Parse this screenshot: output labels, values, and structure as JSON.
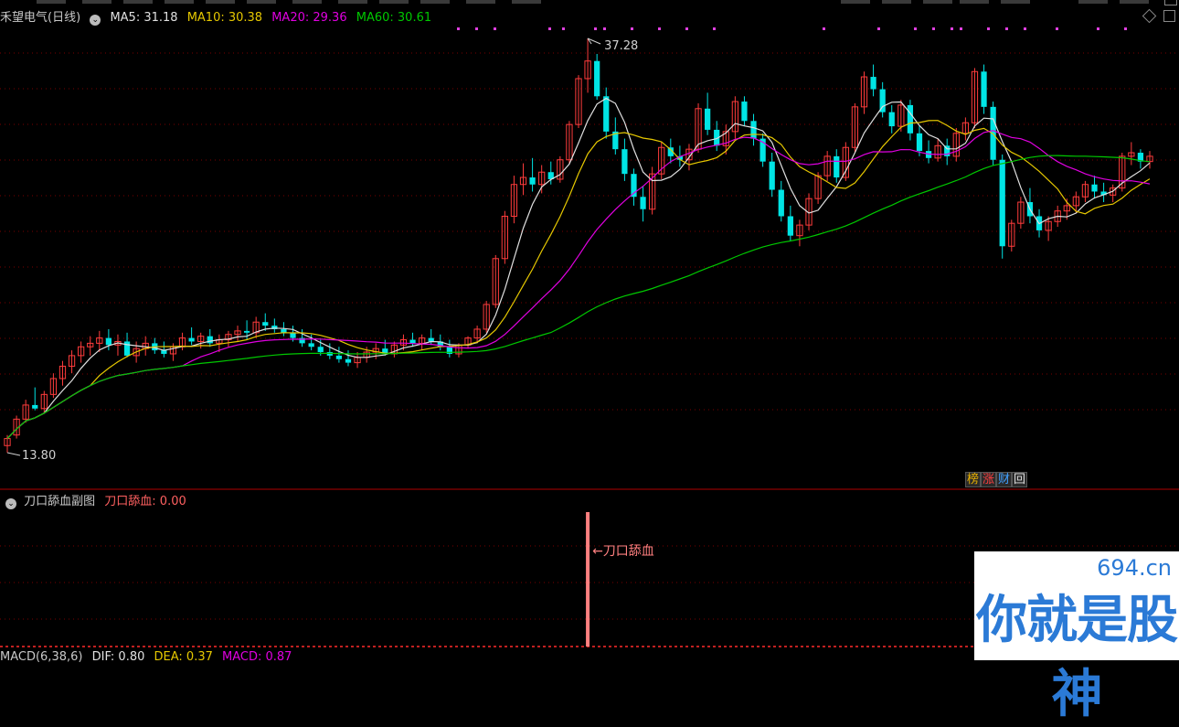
{
  "colors": {
    "up": "#ff3c3c",
    "down": "#00e5e5",
    "ma5": "#e0e0e0",
    "ma10": "#e6c800",
    "ma20": "#e000e0",
    "ma60": "#00c800",
    "bg": "#000000",
    "grid": "#7a0000",
    "signal": "#ff8080",
    "label": "#c8c8c8"
  },
  "main_header": {
    "title": "禾望电气(日线)",
    "ma5": "MA5: 31.18",
    "ma10": "MA10: 30.38",
    "ma20": "MA20: 29.36",
    "ma60": "MA60: 30.61"
  },
  "sub_header": {
    "title": "刀口舔血副图",
    "value": "刀口舔血: 0.00"
  },
  "macd_header": {
    "title": "MACD(6,38,6)",
    "dif": "DIF: 0.80",
    "dea": "DEA: 0.37",
    "macd": "MACD: 0.87"
  },
  "badges": {
    "b1": "榜",
    "b2": "涨",
    "b3": "财",
    "b4": "回"
  },
  "icons": {
    "header_toggle": "chevron-down-icon",
    "ctrl1": "diamond-icon",
    "ctrl2": "square-icon"
  },
  "annotations": {
    "high": "37.28",
    "low": "13.80",
    "signal": "←刀口舔血"
  },
  "watermark": {
    "domain": "694.cn",
    "slogan": "你就是股神"
  },
  "chart_data": {
    "type": "candlestick",
    "title": "禾望电气(日线)",
    "series_names": [
      "MA5",
      "MA10",
      "MA20",
      "MA60"
    ],
    "price_range": [
      13.8,
      37.28
    ],
    "candles": [
      [
        14.2,
        14.8,
        13.8,
        14.6
      ],
      [
        14.8,
        15.9,
        14.6,
        15.7
      ],
      [
        15.7,
        16.8,
        15.5,
        16.5
      ],
      [
        16.5,
        17.5,
        16.2,
        16.3
      ],
      [
        16.3,
        17.3,
        16.0,
        17.1
      ],
      [
        17.1,
        18.3,
        16.9,
        18.0
      ],
      [
        18.0,
        19.0,
        17.6,
        18.7
      ],
      [
        18.7,
        19.6,
        18.3,
        19.3
      ],
      [
        19.3,
        20.1,
        18.9,
        19.8
      ],
      [
        19.8,
        20.4,
        19.3,
        20.0
      ],
      [
        20.0,
        20.7,
        19.5,
        20.3
      ],
      [
        20.3,
        20.8,
        19.6,
        19.9
      ],
      [
        19.9,
        20.5,
        19.3,
        20.1
      ],
      [
        20.1,
        20.6,
        19.2,
        19.3
      ],
      [
        19.3,
        20.1,
        18.9,
        19.7
      ],
      [
        19.7,
        20.4,
        19.3,
        20.0
      ],
      [
        20.0,
        20.3,
        19.4,
        19.6
      ],
      [
        19.6,
        20.1,
        19.2,
        19.4
      ],
      [
        19.4,
        20.0,
        19.0,
        19.8
      ],
      [
        19.8,
        20.6,
        19.6,
        20.3
      ],
      [
        20.3,
        20.9,
        19.9,
        20.1
      ],
      [
        20.1,
        20.6,
        19.7,
        20.4
      ],
      [
        20.4,
        20.8,
        19.8,
        20.0
      ],
      [
        20.0,
        20.5,
        19.5,
        20.2
      ],
      [
        20.2,
        20.7,
        19.8,
        20.5
      ],
      [
        20.5,
        21.0,
        20.1,
        20.7
      ],
      [
        20.7,
        21.3,
        20.2,
        20.6
      ],
      [
        20.6,
        21.5,
        20.3,
        21.2
      ],
      [
        21.2,
        21.7,
        20.7,
        21.0
      ],
      [
        21.0,
        21.4,
        20.6,
        20.8
      ],
      [
        20.8,
        21.2,
        20.4,
        20.6
      ],
      [
        20.6,
        21.0,
        20.1,
        20.3
      ],
      [
        20.3,
        20.8,
        19.8,
        20.0
      ],
      [
        20.0,
        20.5,
        19.6,
        19.8
      ],
      [
        19.8,
        20.2,
        19.3,
        19.5
      ],
      [
        19.5,
        20.0,
        19.1,
        19.3
      ],
      [
        19.3,
        19.8,
        18.9,
        19.1
      ],
      [
        19.1,
        19.6,
        18.7,
        18.9
      ],
      [
        18.9,
        19.5,
        18.6,
        19.2
      ],
      [
        19.2,
        19.8,
        18.9,
        19.5
      ],
      [
        19.5,
        20.0,
        19.1,
        19.7
      ],
      [
        19.7,
        20.2,
        19.3,
        19.4
      ],
      [
        19.4,
        20.1,
        19.2,
        19.9
      ],
      [
        19.9,
        20.5,
        19.6,
        20.2
      ],
      [
        20.2,
        20.6,
        19.8,
        20.0
      ],
      [
        20.0,
        20.5,
        19.6,
        20.3
      ],
      [
        20.3,
        20.8,
        19.9,
        20.1
      ],
      [
        20.1,
        20.5,
        19.6,
        19.8
      ],
      [
        19.8,
        20.2,
        19.2,
        19.4
      ],
      [
        19.4,
        20.0,
        19.2,
        19.9
      ],
      [
        19.9,
        20.4,
        19.7,
        20.3
      ],
      [
        20.3,
        21.0,
        20.0,
        20.8
      ],
      [
        20.8,
        22.4,
        20.6,
        22.2
      ],
      [
        22.2,
        25.0,
        22.0,
        24.8
      ],
      [
        24.8,
        27.5,
        24.5,
        27.2
      ],
      [
        27.2,
        29.5,
        26.8,
        29.0
      ],
      [
        29.0,
        30.2,
        28.4,
        29.4
      ],
      [
        29.4,
        30.5,
        28.6,
        29.0
      ],
      [
        29.0,
        30.1,
        28.5,
        29.7
      ],
      [
        29.7,
        30.3,
        29.0,
        29.3
      ],
      [
        29.3,
        30.6,
        29.1,
        30.4
      ],
      [
        30.4,
        32.6,
        30.2,
        32.4
      ],
      [
        32.4,
        35.2,
        32.2,
        35.0
      ],
      [
        35.0,
        37.28,
        34.2,
        36.0
      ],
      [
        36.0,
        36.4,
        33.8,
        34.0
      ],
      [
        34.0,
        34.5,
        31.6,
        32.0
      ],
      [
        32.0,
        32.8,
        30.7,
        31.0
      ],
      [
        31.0,
        31.6,
        29.2,
        29.6
      ],
      [
        29.6,
        29.9,
        27.8,
        28.3
      ],
      [
        28.3,
        28.9,
        26.9,
        27.6
      ],
      [
        27.6,
        30.0,
        27.3,
        29.6
      ],
      [
        29.6,
        31.4,
        29.3,
        31.1
      ],
      [
        31.1,
        31.6,
        30.2,
        30.6
      ],
      [
        30.6,
        31.2,
        30.0,
        30.4
      ],
      [
        30.4,
        31.3,
        29.8,
        31.0
      ],
      [
        31.0,
        33.6,
        30.8,
        33.3
      ],
      [
        33.3,
        34.2,
        31.8,
        32.1
      ],
      [
        32.1,
        32.6,
        30.9,
        31.2
      ],
      [
        31.2,
        32.4,
        30.7,
        32.0
      ],
      [
        32.0,
        34.0,
        31.6,
        33.7
      ],
      [
        33.7,
        34.0,
        32.3,
        32.6
      ],
      [
        32.6,
        33.0,
        31.2,
        31.6
      ],
      [
        31.6,
        31.9,
        30.0,
        30.3
      ],
      [
        30.3,
        30.8,
        28.3,
        28.7
      ],
      [
        28.7,
        29.2,
        26.9,
        27.2
      ],
      [
        27.2,
        27.8,
        25.8,
        26.1
      ],
      [
        26.1,
        27.0,
        25.5,
        26.7
      ],
      [
        26.7,
        28.5,
        26.4,
        28.2
      ],
      [
        28.2,
        29.7,
        27.9,
        29.5
      ],
      [
        29.5,
        30.9,
        29.2,
        30.6
      ],
      [
        30.6,
        31.0,
        29.1,
        29.4
      ],
      [
        29.4,
        31.4,
        29.2,
        31.1
      ],
      [
        31.1,
        33.6,
        30.8,
        33.4
      ],
      [
        33.4,
        35.4,
        33.0,
        35.1
      ],
      [
        35.1,
        35.8,
        34.0,
        34.4
      ],
      [
        34.4,
        34.8,
        32.8,
        33.1
      ],
      [
        33.1,
        33.5,
        31.9,
        32.3
      ],
      [
        32.3,
        33.8,
        32.0,
        33.5
      ],
      [
        33.5,
        33.8,
        31.5,
        31.9
      ],
      [
        31.9,
        32.3,
        30.6,
        30.9
      ],
      [
        30.9,
        31.5,
        30.2,
        30.5
      ],
      [
        30.5,
        31.6,
        30.3,
        31.2
      ],
      [
        31.2,
        31.6,
        30.1,
        30.6
      ],
      [
        30.6,
        32.2,
        30.3,
        31.9
      ],
      [
        31.9,
        32.8,
        31.5,
        32.5
      ],
      [
        32.5,
        35.6,
        32.2,
        35.4
      ],
      [
        35.4,
        35.8,
        33.0,
        33.4
      ],
      [
        33.4,
        33.7,
        30.1,
        30.4
      ],
      [
        30.4,
        30.7,
        24.8,
        25.5
      ],
      [
        25.5,
        27.0,
        25.2,
        26.8
      ],
      [
        26.8,
        28.3,
        26.5,
        28.0
      ],
      [
        28.0,
        28.8,
        26.8,
        27.2
      ],
      [
        27.2,
        27.6,
        26.0,
        26.4
      ],
      [
        26.4,
        27.2,
        25.8,
        26.9
      ],
      [
        26.9,
        27.8,
        26.6,
        27.5
      ],
      [
        27.5,
        28.2,
        27.0,
        27.8
      ],
      [
        27.8,
        28.6,
        27.4,
        28.3
      ],
      [
        28.3,
        29.2,
        28.0,
        29.0
      ],
      [
        29.0,
        29.5,
        28.2,
        28.6
      ],
      [
        28.6,
        29.1,
        28.0,
        28.4
      ],
      [
        28.4,
        29.0,
        28.0,
        28.8
      ],
      [
        28.8,
        30.8,
        28.6,
        30.6
      ],
      [
        30.6,
        31.4,
        30.1,
        30.8
      ],
      [
        30.8,
        31.0,
        29.9,
        30.3
      ],
      [
        30.3,
        30.9,
        29.9,
        30.6
      ]
    ],
    "sub_signal": {
      "index": 63,
      "value": 1
    }
  }
}
